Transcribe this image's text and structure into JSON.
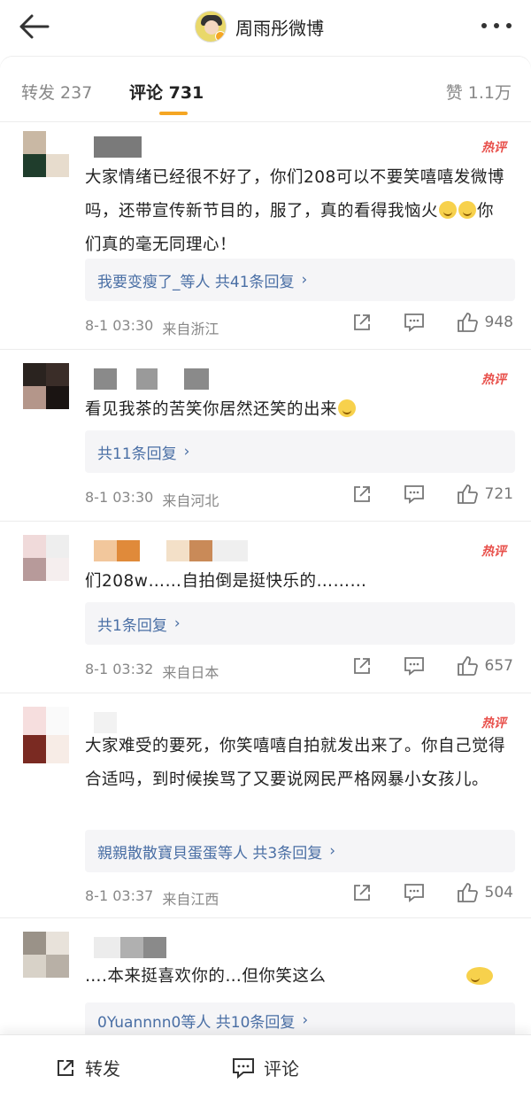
{
  "header": {
    "title": "周雨彤微博"
  },
  "tabs": {
    "repost": "转发 237",
    "comment": "评论 731",
    "like": "赞 1.1万"
  },
  "colors": {
    "accent": "#f5a623",
    "link": "#4a6fa5",
    "hot": "#e8504b"
  },
  "comments": [
    {
      "hot_tag": "热评",
      "text_a": "大家情绪已经很不好了，你们208可以不要笑嘻嘻发微博吗，还带宣传新节目的，服了，真的看得我恼火",
      "text_b": "你们真的毫无同理心！",
      "reply_text": "我要变瘦了_等人  共41条回复",
      "time": "8-1 03:30",
      "location": "来自浙江",
      "likes": "948"
    },
    {
      "hot_tag": "热评",
      "text_a": "看见我茶的苦笑你居然还笑的出来",
      "text_b": "",
      "reply_text": "共11条回复",
      "time": "8-1 03:30",
      "location": "来自河北",
      "likes": "721"
    },
    {
      "hot_tag": "热评",
      "text_a": "们208w……自拍倒是挺快乐的………",
      "text_b": "",
      "reply_text": "共1条回复",
      "time": "8-1 03:32",
      "location": "来自日本",
      "likes": "657"
    },
    {
      "hot_tag": "热评",
      "text_a": "大家难受的要死，你笑嘻嘻自拍就发出来了。你自己觉得合适吗，到时候挨骂了又要说网民严格网暴小女孩儿。",
      "text_b": "",
      "reply_text": "親親散散寶貝蛋蛋等人  共3条回复",
      "time": "8-1 03:37",
      "location": "来自江西",
      "likes": "504"
    },
    {
      "hot_tag": "",
      "text_a": "….本来挺喜欢你的…但你笑这么",
      "text_b": "",
      "reply_text": "0Yuannnn0等人  共10条回复",
      "time": "",
      "location": "",
      "likes": ""
    }
  ],
  "bottom": {
    "repost": "转发",
    "comment": "评论"
  },
  "icons": [
    "back-arrow-icon",
    "more-icon",
    "share-icon",
    "comment-icon",
    "thumbs-up-icon",
    "chevron-right-icon"
  ]
}
